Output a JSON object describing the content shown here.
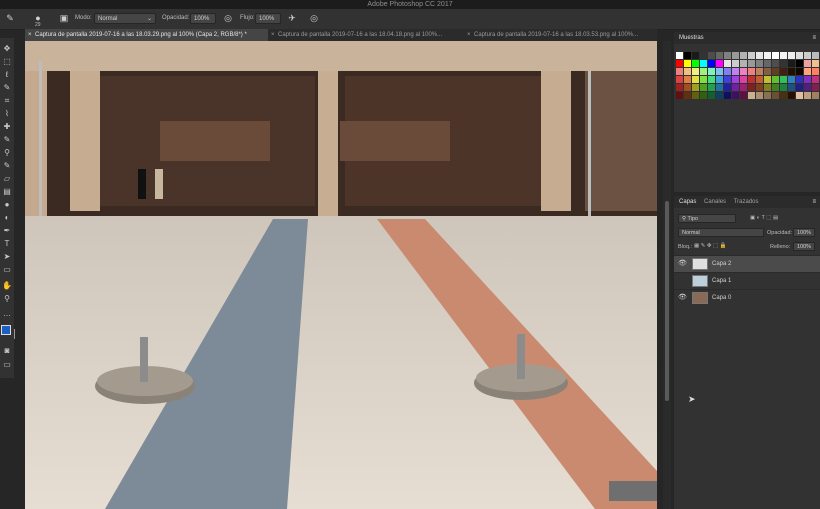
{
  "app": {
    "title": "Adobe Photoshop CC 2017"
  },
  "options": {
    "brush_size": "29",
    "mode_label": "Modo:",
    "mode_value": "Normal",
    "opacity_label": "Opacidad:",
    "opacity_value": "100%",
    "flow_label": "Flujo:",
    "flow_value": "100%"
  },
  "tabs": [
    {
      "label": "Captura de pantalla 2019-07-16 a las 18.03.29.png al 100% (Capa 2, RGB/8*) *",
      "active": true
    },
    {
      "label": "Captura de pantalla 2019-07-16 a las 18.04.18.png al 100%...",
      "active": false
    },
    {
      "label": "Captura de pantalla 2019-07-16 a las 18.03.53.png al 100%...",
      "active": false
    }
  ],
  "swatches": {
    "title": "Muestras"
  },
  "layers_panel": {
    "tabs": [
      "Capas",
      "Canales",
      "Trazados"
    ],
    "filter_value": "Tipo",
    "blend_mode": "Normal",
    "opacity_label": "Opacidad:",
    "opacity_value": "100%",
    "lock_label": "Bloq.:",
    "fill_label": "Relleno:",
    "fill_value": "100%",
    "layers": [
      {
        "name": "Capa 2",
        "selected": true,
        "visible": true
      },
      {
        "name": "Capa 1",
        "selected": false,
        "visible": false
      },
      {
        "name": "Capa 0",
        "selected": false,
        "visible": true
      }
    ]
  },
  "colors": {
    "accent": "#2d8ceb",
    "panel_bg": "#323232",
    "app_bg": "#262626"
  }
}
